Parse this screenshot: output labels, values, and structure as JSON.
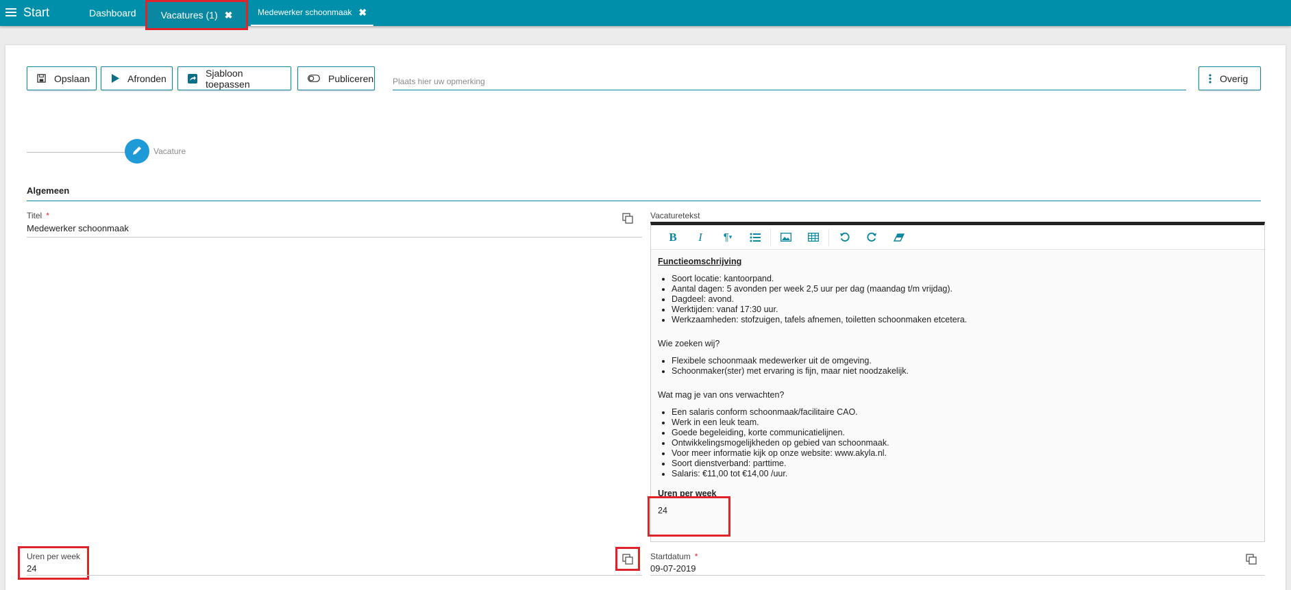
{
  "topbar": {
    "menu_label": "Start",
    "tabs": [
      {
        "label": "Dashboard"
      },
      {
        "label": "Vacatures (1)"
      },
      {
        "label": "Medewerker schoonmaak"
      }
    ]
  },
  "toolbar": {
    "save_label": "Opslaan",
    "finish_label": "Afronden",
    "template_label": "Sjabloon toepassen",
    "publish_label": "Publiceren",
    "remark_placeholder": "Plaats hier uw opmerking",
    "other_label": "Overig"
  },
  "step": {
    "label": "Vacature"
  },
  "section": {
    "title": "Algemeen"
  },
  "fields": {
    "titel_label": "Titel",
    "titel_value": "Medewerker schoonmaak",
    "vacaturetekst_label": "Vacaturetekst",
    "uren_label": "Uren per week",
    "uren_value": "24",
    "startdatum_label": "Startdatum",
    "startdatum_value": "09-07-2019",
    "required_mark": "*"
  },
  "editor": {
    "heading": "Functieomschrijving",
    "list1": [
      "Soort locatie: kantoorpand.",
      "Aantal dagen: 5 avonden per week 2,5 uur per dag (maandag t/m vrijdag).",
      "Dagdeel: avond.",
      "Werktijden: vanaf 17:30 uur.",
      "Werkzaamheden: stofzuigen, tafels afnemen, toiletten schoonmaken etcetera."
    ],
    "q1": "Wie zoeken wij?",
    "list2": [
      "Flexibele schoonmaak medewerker uit de omgeving.",
      "Schoonmaker(ster) met ervaring is fijn, maar niet noodzakelijk."
    ],
    "q2": "Wat mag je van ons verwachten?",
    "list3": [
      "Een salaris conform schoonmaak/facilitaire CAO.",
      "Werk in een leuk team.",
      "Goede begeleiding, korte communicatielijnen.",
      "Ontwikkelingsmogelijkheden op gebied van schoonmaak.",
      "Voor meer informatie kijk op onze website: www.akyla.nl.",
      "Soort dienstverband: parttime.",
      "Salaris: €11,00 tot €14,00 /uur."
    ],
    "uren_heading": "Uren per week",
    "uren_value": "24"
  },
  "colors": {
    "topbar": "#008fab",
    "accent": "#0a87a1",
    "highlight": "#e0222b",
    "step": "#1e9bd7"
  }
}
